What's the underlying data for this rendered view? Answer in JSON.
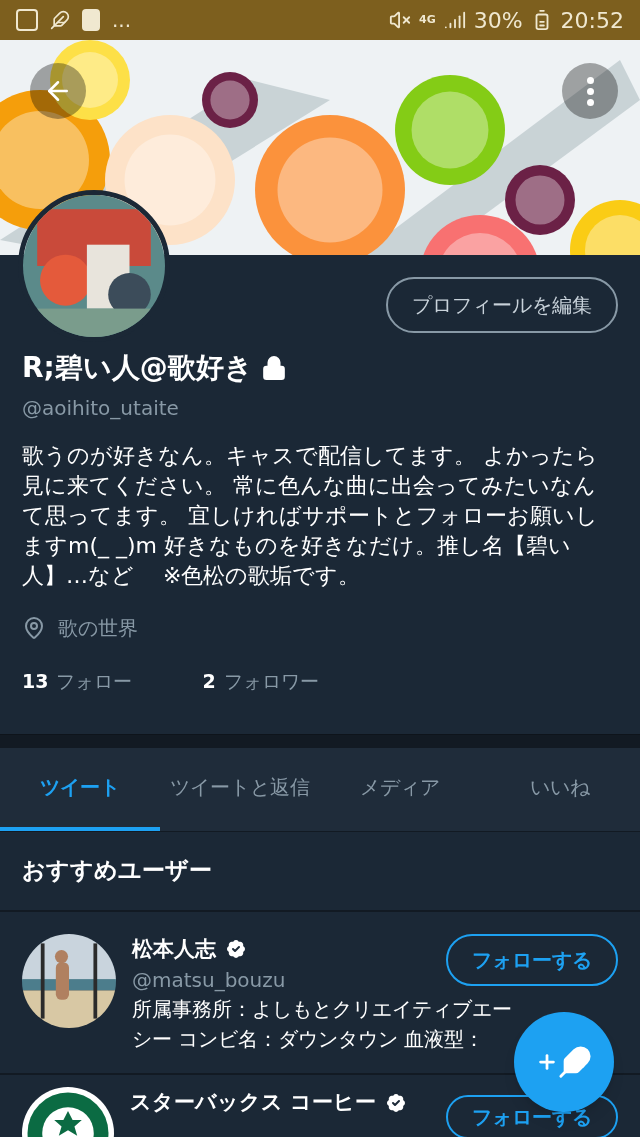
{
  "status_bar": {
    "overflow": "...",
    "network": "4G",
    "battery": "30%",
    "time": "20:52"
  },
  "profile": {
    "edit_button": "プロフィールを編集",
    "name": "R;碧い人@歌好き",
    "protected": true,
    "handle": "@aoihito_utaite",
    "bio": "歌うのが好きなん。キャスで配信してます。 よかったら見に来てください。 常に色んな曲に出会ってみたいなんて思ってます。 宜しければサポートとフォローお願いしますm(_ _)m 好きなものを好きなだけ。推し名【碧い人】…など　 ※色松の歌垢です。",
    "location": "歌の世界",
    "following_count": "13",
    "following_label": "フォロー",
    "followers_count": "2",
    "followers_label": "フォロワー"
  },
  "tabs": [
    {
      "label": "ツイート",
      "selected": true
    },
    {
      "label": "ツイートと返信",
      "selected": false
    },
    {
      "label": "メディア",
      "selected": false
    },
    {
      "label": "いいね",
      "selected": false
    }
  ],
  "recommended": {
    "title": "おすすめユーザー",
    "users": [
      {
        "name": "松本人志",
        "verified": true,
        "handle": "@matsu_bouzu",
        "bio_lines": [
          "所属事務所：よしもとクリエイティブエー",
          "シー コンビ名：ダウンタウン 血液型："
        ],
        "button": "フォローする"
      },
      {
        "name": "スターバックス コーヒー",
        "verified": true,
        "button": "フォローする",
        "kind": "logo"
      }
    ]
  }
}
